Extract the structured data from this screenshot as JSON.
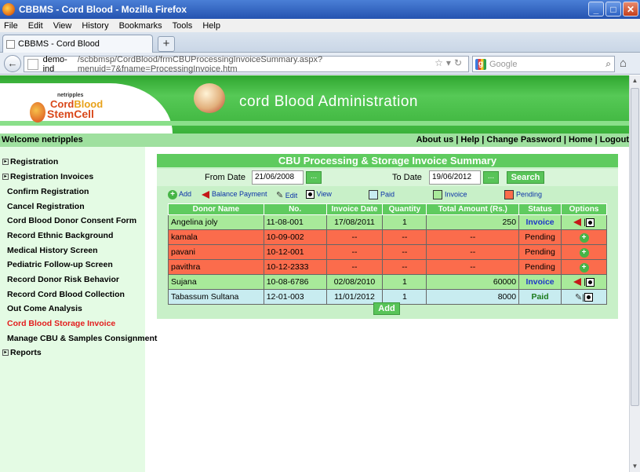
{
  "window": {
    "title": "CBBMS - Cord Blood - Mozilla Firefox"
  },
  "menubar": [
    "File",
    "Edit",
    "View",
    "History",
    "Bookmarks",
    "Tools",
    "Help"
  ],
  "tab": {
    "label": "CBBMS - Cord Blood"
  },
  "nav": {
    "url_host": "demo-ind",
    "url_path": "/scbbmsp/CordBlood/frmCBUProcessingInvoiceSummary.aspx?menuid=7&fname=ProcessingInvoice.htm",
    "search_placeholder": "Google"
  },
  "header": {
    "logo_top": "netripples",
    "logo_line1a": "Cord",
    "logo_line1b": "Blood",
    "logo_line2": "StemCell",
    "admin_title": "cord Blood Administration",
    "welcome": "Welcome netripples",
    "links": "About us | Help | Change Password | Home | Logout"
  },
  "sidebar": {
    "items": [
      {
        "label": "Registration",
        "expandable": true
      },
      {
        "label": "Registration Invoices",
        "expandable": true
      },
      {
        "label": "Confirm Registration"
      },
      {
        "label": "Cancel Registration"
      },
      {
        "label": "Cord Blood Donor Consent Form"
      },
      {
        "label": "Record Ethnic Background"
      },
      {
        "label": "Medical History Screen"
      },
      {
        "label": "Pediatric Follow-up Screen"
      },
      {
        "label": "Record Donor Risk Behavior"
      },
      {
        "label": "Record Cord Blood Collection"
      },
      {
        "label": "Out Come Analysis"
      },
      {
        "label": "Cord Blood Storage Invoice",
        "active": true
      },
      {
        "label": "Manage CBU & Samples Consignment"
      },
      {
        "label": "Reports",
        "expandable": true
      }
    ]
  },
  "main": {
    "title": "CBU Processing & Storage Invoice Summary",
    "from_label": "From Date",
    "from_value": "21/06/2008",
    "to_label": "To Date",
    "to_value": "19/06/2012",
    "picker_label": "...",
    "search_label": "Search",
    "legend": {
      "add": "Add",
      "balance": "Balance Payment",
      "edit": "Edit",
      "view": "View",
      "paid": "Paid",
      "invoice": "Invoice",
      "pending": "Pending"
    },
    "colors": {
      "paid": "#c8ecf0",
      "invoice": "#a8ea9a",
      "pending": "#fb6c4c",
      "header": "#5fcb5f"
    },
    "columns": [
      "Donor Name",
      "No.",
      "Invoice Date",
      "Quantity",
      "Total Amount (Rs.)",
      "Status",
      "Options"
    ],
    "rows": [
      {
        "name": "Angelina joly",
        "no": "11-08-001",
        "date": "17/08/2011",
        "qty": "1",
        "amount": "250",
        "status": "Invoice"
      },
      {
        "name": "kamala",
        "no": "10-09-002",
        "date": "--",
        "qty": "--",
        "amount": "--",
        "status": "Pending"
      },
      {
        "name": "pavani",
        "no": "10-12-001",
        "date": "--",
        "qty": "--",
        "amount": "--",
        "status": "Pending"
      },
      {
        "name": "pavithra",
        "no": "10-12-2333",
        "date": "--",
        "qty": "--",
        "amount": "--",
        "status": "Pending"
      },
      {
        "name": "Sujana",
        "no": "10-08-6786",
        "date": "02/08/2010",
        "qty": "1",
        "amount": "60000",
        "status": "Invoice"
      },
      {
        "name": "Tabassum Sultana",
        "no": "12-01-003",
        "date": "11/01/2012",
        "qty": "1",
        "amount": "8000",
        "status": "Paid"
      }
    ],
    "add_label": "Add"
  }
}
